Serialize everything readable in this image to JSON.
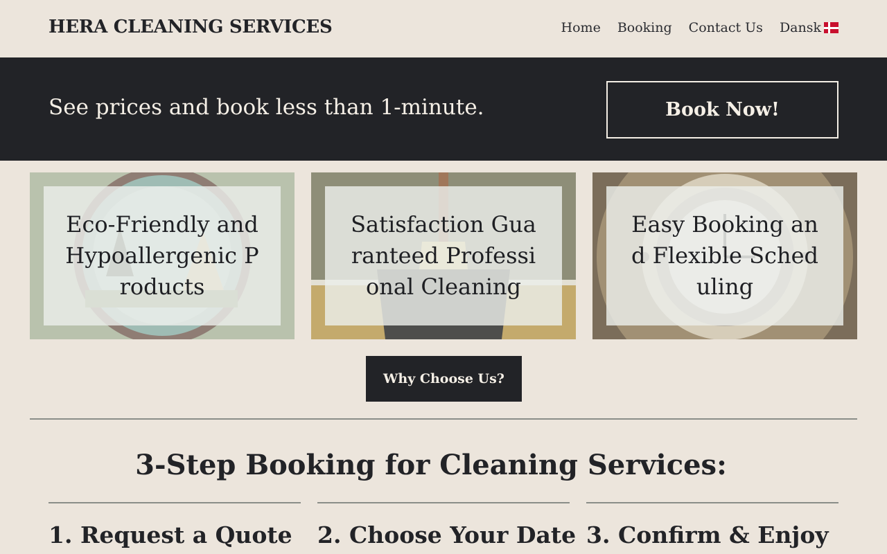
{
  "header": {
    "brand": "HERA CLEANING SERVICES",
    "nav": [
      "Home",
      "Booking",
      "Contact Us",
      "Dansk"
    ],
    "flag_icon": "denmark-flag-icon"
  },
  "banner": {
    "text": "See prices and book less than 1-minute.",
    "button_label": "Book Now!"
  },
  "features": [
    {
      "title": "Eco-Friendly and Hypoallergenic Products",
      "icon": "tree-badge-icon"
    },
    {
      "title": "Satisfaction Guaranteed Professional Cleaning",
      "icon": "broom-bucket-icon"
    },
    {
      "title": "Easy Booking and Flexible Scheduling",
      "icon": "alarm-clock-icon"
    }
  ],
  "why_button": "Why Choose Us?",
  "steps_section": {
    "title": "3-Step Booking for Cleaning Services:",
    "steps": [
      "1. Request a Quote",
      "2. Choose Your Date",
      "3. Confirm & Enjoy"
    ]
  },
  "colors": {
    "background": "#ece5dc",
    "dark": "#222327",
    "light_text": "#f5efe6"
  }
}
